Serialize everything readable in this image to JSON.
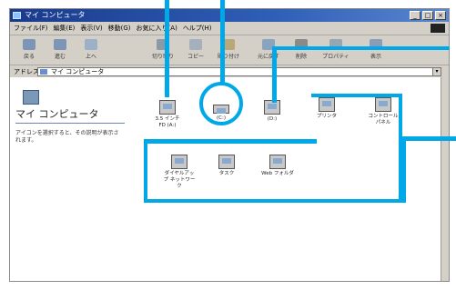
{
  "window": {
    "title": "マイ コンピュータ"
  },
  "menu": [
    "ファイル(F)",
    "編集(E)",
    "表示(V)",
    "移動(G)",
    "お気に入り(A)",
    "ヘルプ(H)"
  ],
  "toolbar": [
    "戻る",
    "進む",
    "上へ",
    "切り取り",
    "コピー",
    "貼り付け",
    "元に戻す",
    "削除",
    "プロパティ",
    "表示"
  ],
  "address": {
    "label": "アドレス",
    "value": "マイ コンピュータ"
  },
  "left_pane": {
    "title": "マイ コンピュータ",
    "description": "アイコンを選択すると、その説明が表示されます。"
  },
  "items": [
    {
      "label": "3.5 インチ FD (A:)"
    },
    {
      "label": "(C:)"
    },
    {
      "label": "(D:)"
    },
    {
      "label": "プリンタ"
    },
    {
      "label": "コントロール パネル"
    },
    {
      "label": "ダイヤルアップ ネットワーク"
    },
    {
      "label": "タスク"
    },
    {
      "label": "Web フォルダ"
    }
  ]
}
